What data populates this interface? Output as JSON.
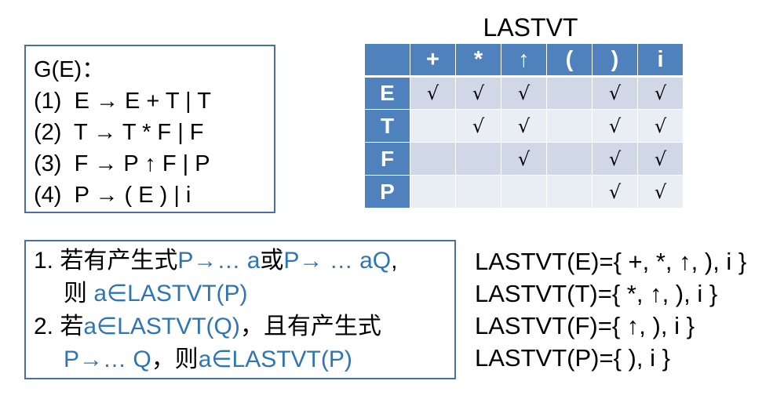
{
  "grammar": {
    "title": "G(E)：",
    "rules": [
      {
        "num": "(1)",
        "text": "E → E + T | T"
      },
      {
        "num": "(2)",
        "text": "T → T * F | F"
      },
      {
        "num": "(3)",
        "text": "F → P ↑ F | P"
      },
      {
        "num": "(4)",
        "text": "P → ( E ) | i"
      }
    ]
  },
  "table": {
    "title": "LASTVT",
    "columns": [
      "+",
      "*",
      "↑",
      "(",
      ")",
      "i"
    ],
    "rows": [
      {
        "label": "E",
        "cells": [
          "√",
          "√",
          "√",
          "",
          "√",
          "√"
        ]
      },
      {
        "label": "T",
        "cells": [
          "",
          "√",
          "√",
          "",
          "√",
          "√"
        ]
      },
      {
        "label": "F",
        "cells": [
          "",
          "",
          "√",
          "",
          "√",
          "√"
        ]
      },
      {
        "label": "P",
        "cells": [
          "",
          "",
          "",
          "",
          "√",
          "√"
        ]
      }
    ]
  },
  "construction_rules": {
    "rule1": {
      "prefix": "1. 若有产生式",
      "part_a": "P→… a",
      "or": "或",
      "part_b": "P→ … aQ",
      "comma": ",",
      "then": "则 ",
      "result": "a∈LASTVT(P)"
    },
    "rule2": {
      "prefix": "2. 若",
      "cond": "a∈LASTVT(Q)",
      "mid": "，且有产生式",
      "prod": "P→… Q",
      "then": "，则",
      "result": "a∈LASTVT(P)"
    }
  },
  "results": [
    "LASTVT(E)={ +, *, ↑, ), i }",
    "LASTVT(T)={ *, ↑, ), i }",
    "LASTVT(F)={ ↑, ), i }",
    "LASTVT(P)={ ), i }"
  ],
  "colors": {
    "accent_blue": "#2e75b6",
    "table_header": "#4f81bd",
    "table_row_dark": "#d0d8e8",
    "table_row_light": "#e9edf4",
    "box_border": "#4a6fa5"
  }
}
